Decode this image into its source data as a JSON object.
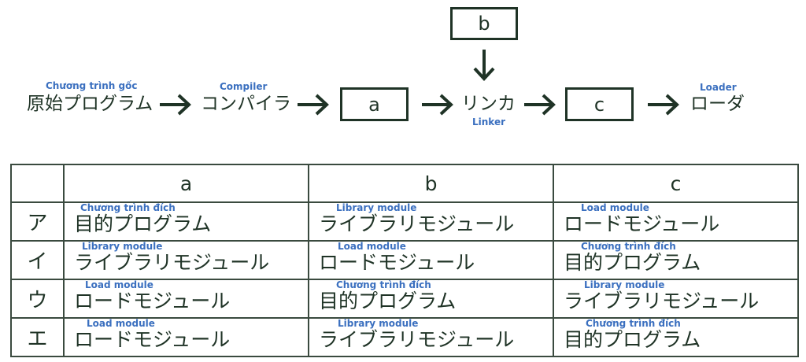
{
  "diagram": {
    "source_program": "原始プログラム",
    "source_program_note": "Chương trình gốc",
    "compiler": "コンパイラ",
    "compiler_note": "Compiler",
    "box_a": "a",
    "box_b": "b",
    "box_c": "c",
    "linker": "リンカ",
    "linker_note": "Linker",
    "loader": "ローダ",
    "loader_note": "Loader"
  },
  "table": {
    "headers": [
      "",
      "a",
      "b",
      "c"
    ],
    "rows": [
      {
        "label": "ア",
        "cells": [
          {
            "text": "目的プログラム",
            "note": "Chương trình đích"
          },
          {
            "text": "ライブラリモジュール",
            "note": "Library module"
          },
          {
            "text": "ロードモジュール",
            "note": "Load module"
          }
        ]
      },
      {
        "label": "イ",
        "cells": [
          {
            "text": "ライブラリモジュール",
            "note": "Library module"
          },
          {
            "text": "ロードモジュール",
            "note": "Load module"
          },
          {
            "text": "目的プログラム",
            "note": "Chương trình đích"
          }
        ]
      },
      {
        "label": "ウ",
        "cells": [
          {
            "text": "ロードモジュール",
            "note": "Load module"
          },
          {
            "text": "目的プログラム",
            "note": "Chương trình đích"
          },
          {
            "text": "ライブラリモジュール",
            "note": "Library module"
          }
        ]
      },
      {
        "label": "エ",
        "cells": [
          {
            "text": "ロードモジュール",
            "note": "Load module"
          },
          {
            "text": "ライブラリモジュール",
            "note": "Library module"
          },
          {
            "text": "目的プログラム",
            "note": "Chương trình đích"
          }
        ]
      }
    ]
  }
}
